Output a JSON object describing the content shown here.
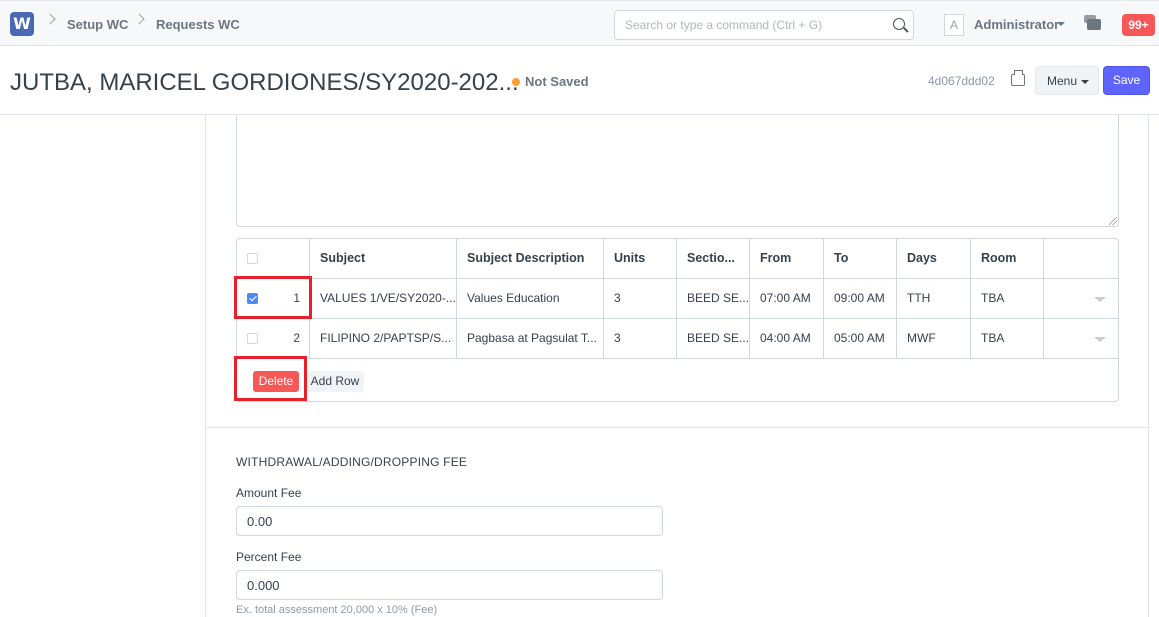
{
  "navbar": {
    "logo": "W",
    "breadcrumbs": [
      "Setup WC",
      "Requests WC"
    ],
    "search_placeholder": "Search or type a command (Ctrl + G)",
    "avatar_letter": "A",
    "user": "Administrator",
    "notifications": "99+"
  },
  "header": {
    "title": "JUTBA, MARICEL GORDIONES/SY2020-202...",
    "status": "Not Saved",
    "doc_id": "4d067ddd02",
    "menu_label": "Menu",
    "save_label": "Save"
  },
  "grid": {
    "columns": [
      "Subject",
      "Subject Description",
      "Units",
      "Sectio...",
      "From",
      "To",
      "Days",
      "Room"
    ],
    "rows": [
      {
        "idx": "1",
        "checked": true,
        "subject": "VALUES 1/VE/SY2020-...",
        "description": "Values Education",
        "units": "3",
        "section": "BEED SE...",
        "from": "07:00 AM",
        "to": "09:00 AM",
        "days": "TTH",
        "room": "TBA"
      },
      {
        "idx": "2",
        "checked": false,
        "subject": "FILIPINO 2/PAPTSP/S...",
        "description": "Pagbasa at Pagsulat T...",
        "units": "3",
        "section": "BEED SE...",
        "from": "04:00 AM",
        "to": "05:00 AM",
        "days": "MWF",
        "room": "TBA"
      }
    ],
    "delete_label": "Delete",
    "add_row_label": "Add Row"
  },
  "fees": {
    "section_title": "WITHDRAWAL/ADDING/DROPPING FEE",
    "amount_label": "Amount Fee",
    "amount_value": "0.00",
    "percent_label": "Percent Fee",
    "percent_value": "0.000",
    "percent_help": "Ex. total assessment 20,000 x 10% (Fee)"
  },
  "colors": {
    "primary": "#5e64ff",
    "danger": "#f65757",
    "highlight": "#e8202a",
    "indicator": "#ff9d2c"
  }
}
